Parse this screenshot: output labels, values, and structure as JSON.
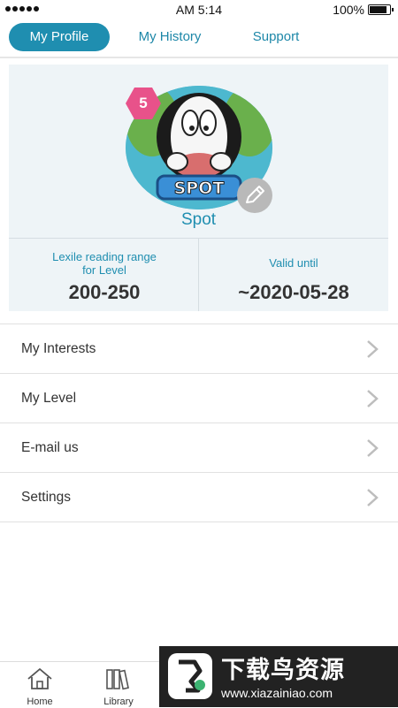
{
  "status_bar": {
    "time": "AM 5:14",
    "battery": "100%"
  },
  "tabs": [
    {
      "label": "My Profile",
      "active": true
    },
    {
      "label": "My History",
      "active": false
    },
    {
      "label": "Support",
      "active": false
    }
  ],
  "profile": {
    "name": "Spot",
    "level": "5",
    "avatar_tag": "SPOT",
    "lexile_label_line1": "Lexile reading range",
    "lexile_label_line2": "for Level",
    "lexile_value": "200-250",
    "valid_label": "Valid until",
    "valid_value": "~2020-05-28"
  },
  "menu": [
    {
      "label": "My Interests"
    },
    {
      "label": "My Level"
    },
    {
      "label": "E-mail us"
    },
    {
      "label": "Settings"
    }
  ],
  "bottom_nav": [
    {
      "label": "Home",
      "icon": "home-icon"
    },
    {
      "label": "Library",
      "icon": "library-icon"
    }
  ],
  "watermark": {
    "title": "下载鸟资源",
    "url": "www.xiazainiao.com"
  },
  "colors": {
    "accent": "#1f8eb0",
    "badge": "#e8528a",
    "card_bg": "#eef4f7"
  }
}
